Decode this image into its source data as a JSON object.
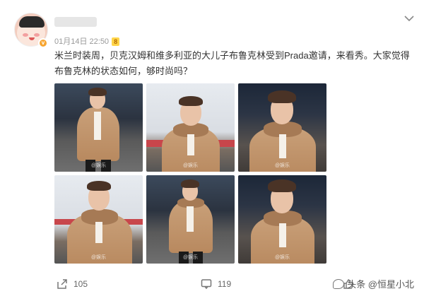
{
  "post": {
    "date": "01月14日 22:50",
    "level_badge": "8",
    "verified_badge": "v",
    "text": "米兰时装周，贝克汉姆和维多利亚的大儿子布鲁克林受到Prada邀请，来看秀。大家觉得布鲁克林的状态如何，够时尚吗？",
    "photo_watermark": "@娱乐"
  },
  "actions": {
    "share_count": "105",
    "comment_count": "119"
  },
  "watermark": {
    "text": "头条 @恒星小北"
  },
  "icons": {
    "more": "chevron-down-icon",
    "share": "share-icon",
    "comment": "comment-icon",
    "like": "like-icon"
  },
  "colors": {
    "accent_badge": "#f7a531",
    "level_badge": "#ffd54a",
    "coat": "#b8895f"
  }
}
